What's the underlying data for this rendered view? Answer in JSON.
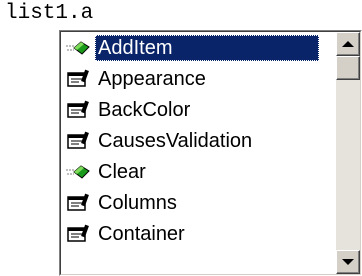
{
  "editor": {
    "code_text": "list1.a"
  },
  "autocomplete": {
    "items": [
      {
        "label": "AddItem",
        "kind": "method",
        "icon": "method-icon",
        "selected": true
      },
      {
        "label": "Appearance",
        "kind": "property",
        "icon": "property-icon",
        "selected": false
      },
      {
        "label": "BackColor",
        "kind": "property",
        "icon": "property-icon",
        "selected": false
      },
      {
        "label": "CausesValidation",
        "kind": "property",
        "icon": "property-icon",
        "selected": false
      },
      {
        "label": "Clear",
        "kind": "method",
        "icon": "method-icon",
        "selected": false
      },
      {
        "label": "Columns",
        "kind": "property",
        "icon": "property-icon",
        "selected": false
      },
      {
        "label": "Container",
        "kind": "property",
        "icon": "property-icon",
        "selected": false
      }
    ]
  },
  "colors": {
    "selection_bg": "#0a246a",
    "selection_fg": "#ffffff",
    "method_icon": "#1a9a1a",
    "scrollbar_face": "#d4d0c8"
  }
}
